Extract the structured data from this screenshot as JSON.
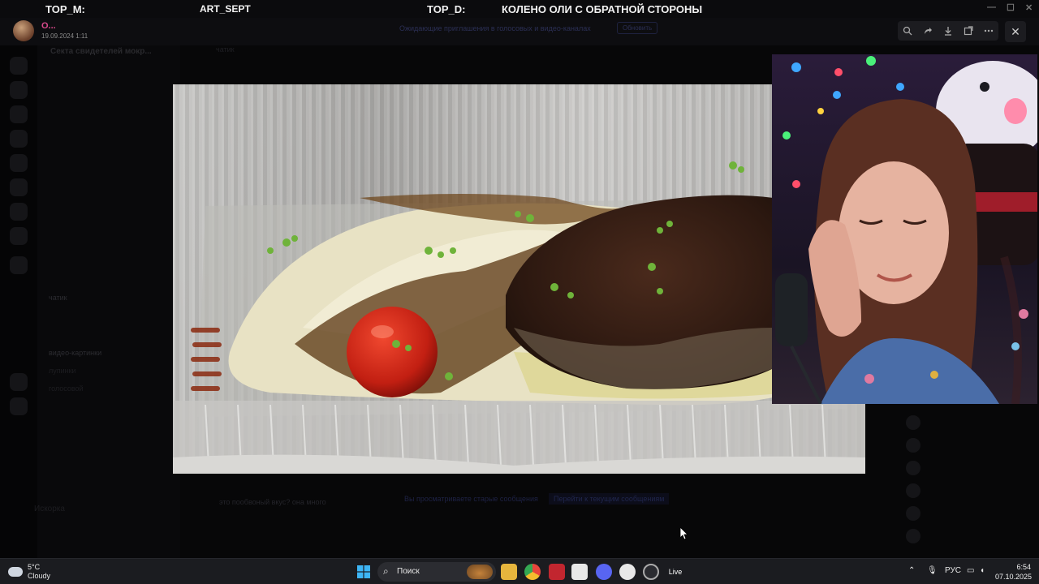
{
  "overlay": {
    "top_m_label": "TOP_M:",
    "art_label": "ART_SEPT",
    "top_d_label": "TOP_D:",
    "top_d_value": "КОЛЕНО ОЛИ С ОБРАТНОЙ СТОРОНЫ"
  },
  "viewer": {
    "username": "О...",
    "date": "19.09.2024 1:11",
    "notice_text": "Ожидающие приглашения в голосовых и видео-каналах",
    "notice_button": "Обновить",
    "tools": [
      "zoom-in-icon",
      "forward-icon",
      "download-icon",
      "open-external-icon",
      "more-icon"
    ],
    "close_label": "✕"
  },
  "background": {
    "server_title": "Секта свидетелей мокр...",
    "channels": [
      "чатик",
      "видео-картинки",
      "лупинки",
      "голосовой"
    ],
    "tab_label": "чатик",
    "chat_message": "это пообвоный вкус? она много",
    "chat_status": "Вы просматриваете старые сообщения",
    "chat_status_button": "Перейти к текущим сообщениям",
    "user_footer": "Искорка"
  },
  "taskbar": {
    "weather_temp": "5°C",
    "weather_cond": "Cloudy",
    "search_placeholder": "Поиск",
    "apps": [
      "start-icon",
      "file-explorer-icon",
      "chrome-icon",
      "news-icon",
      "photos-icon",
      "discord-icon",
      "app-icon",
      "steam-icon",
      "live-icon"
    ],
    "live_label": "Live",
    "lang": "РУС",
    "time": "6:54",
    "date": "07.10.2025"
  }
}
